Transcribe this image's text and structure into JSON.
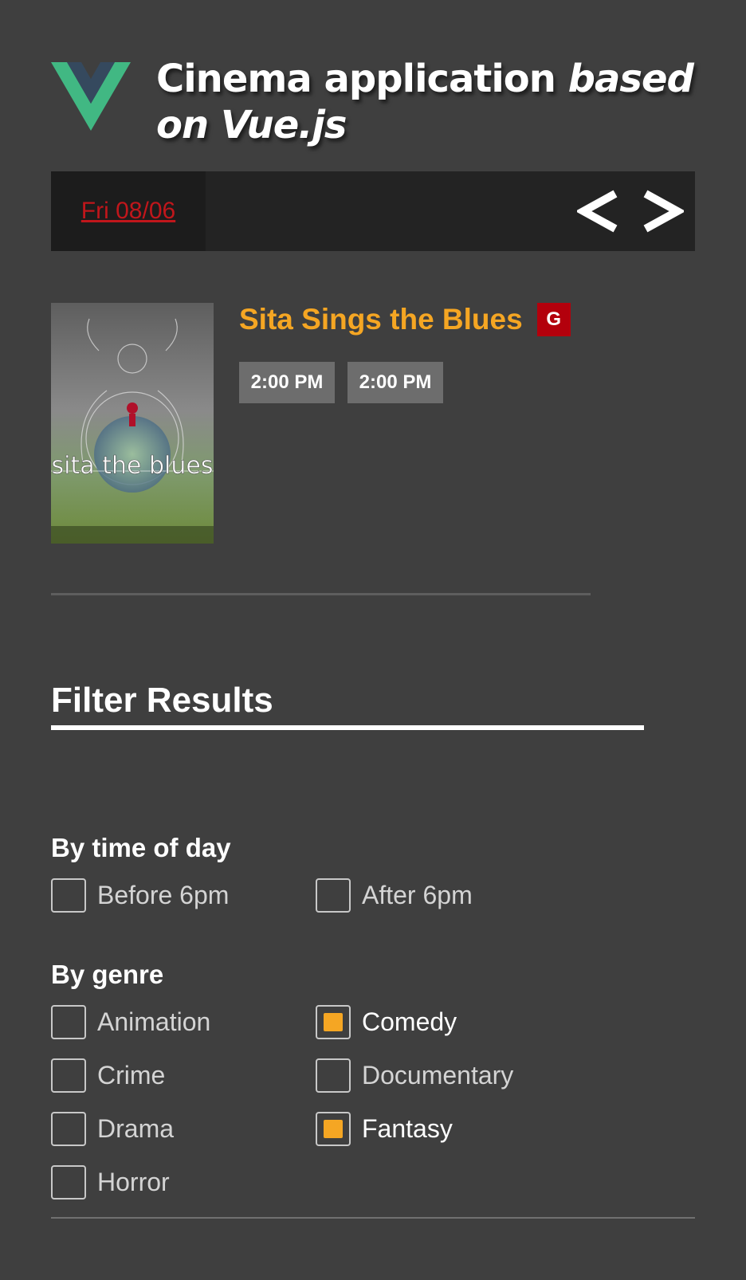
{
  "header": {
    "title_main": "Cinema application ",
    "title_em": "based on Vue.js"
  },
  "date_bar": {
    "selected_date": "Fri 08/06",
    "prev_label": "<",
    "next_label": ">"
  },
  "movie": {
    "title": "Sita Sings the Blues",
    "rating": "G",
    "showtimes": [
      "2:00 PM",
      "2:00 PM"
    ]
  },
  "filters": {
    "title": "Filter Results",
    "time_group": {
      "title": "By time of day",
      "options": [
        {
          "label": "Before 6pm",
          "checked": false
        },
        {
          "label": "After 6pm",
          "checked": false
        }
      ]
    },
    "genre_group": {
      "title": "By genre",
      "options": [
        {
          "label": "Animation",
          "checked": false
        },
        {
          "label": "Comedy",
          "checked": true
        },
        {
          "label": "Crime",
          "checked": false
        },
        {
          "label": "Documentary",
          "checked": false
        },
        {
          "label": "Drama",
          "checked": false
        },
        {
          "label": "Fantasy",
          "checked": true
        },
        {
          "label": "Horror",
          "checked": false
        }
      ]
    }
  },
  "colors": {
    "background": "#3f3f3f",
    "accent": "#f5a623",
    "date_link": "#c0161b",
    "rating_badge": "#b3000c",
    "vue_green": "#41b883",
    "vue_dark": "#35495e"
  },
  "icons": {
    "logo": "vue-logo",
    "prev": "chevron-left-icon",
    "next": "chevron-right-icon"
  }
}
